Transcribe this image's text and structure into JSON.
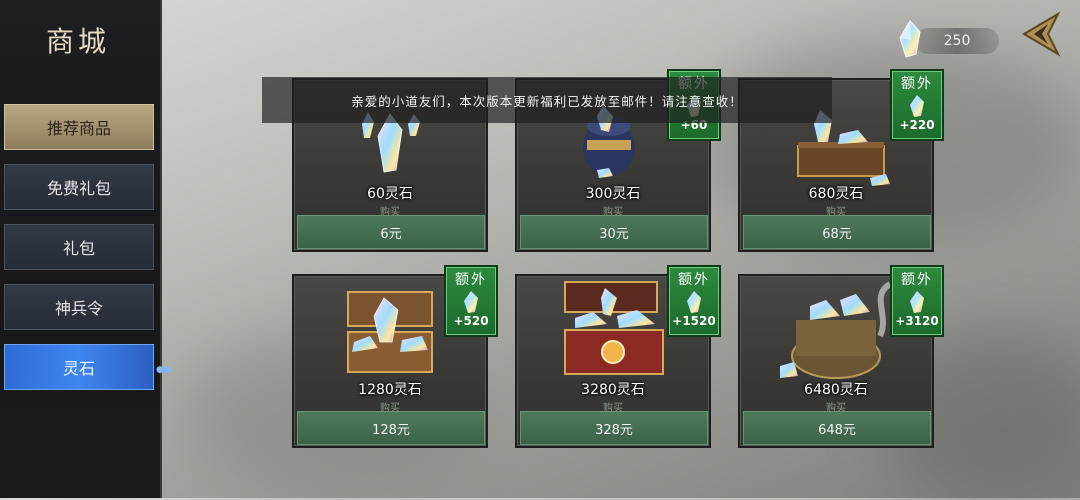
{
  "sidebar": {
    "title": "商城",
    "items": [
      {
        "label": "推荐商品"
      },
      {
        "label": "免费礼包"
      },
      {
        "label": "礼包"
      },
      {
        "label": "神兵令"
      },
      {
        "label": "灵石"
      }
    ]
  },
  "currency": {
    "amount": "250",
    "icon": "spirit-stone-icon"
  },
  "notice": "亲爱的小道友们，本次版本更新福利已发放至邮件！请注意查收！",
  "products": [
    {
      "name": "60灵石",
      "buy_label": "购买",
      "price": "6元",
      "bonus_title": "",
      "bonus": ""
    },
    {
      "name": "300灵石",
      "buy_label": "购买",
      "price": "30元",
      "bonus_title": "额外",
      "bonus": "+60"
    },
    {
      "name": "680灵石",
      "buy_label": "购买",
      "price": "68元",
      "bonus_title": "额外",
      "bonus": "+220"
    },
    {
      "name": "1280灵石",
      "buy_label": "购买",
      "price": "128元",
      "bonus_title": "额外",
      "bonus": "+520"
    },
    {
      "name": "3280灵石",
      "buy_label": "购买",
      "price": "328元",
      "bonus_title": "额外",
      "bonus": "+1520"
    },
    {
      "name": "6480灵石",
      "buy_label": "购买",
      "price": "648元",
      "bonus_title": "额外",
      "bonus": "+3120"
    }
  ]
}
